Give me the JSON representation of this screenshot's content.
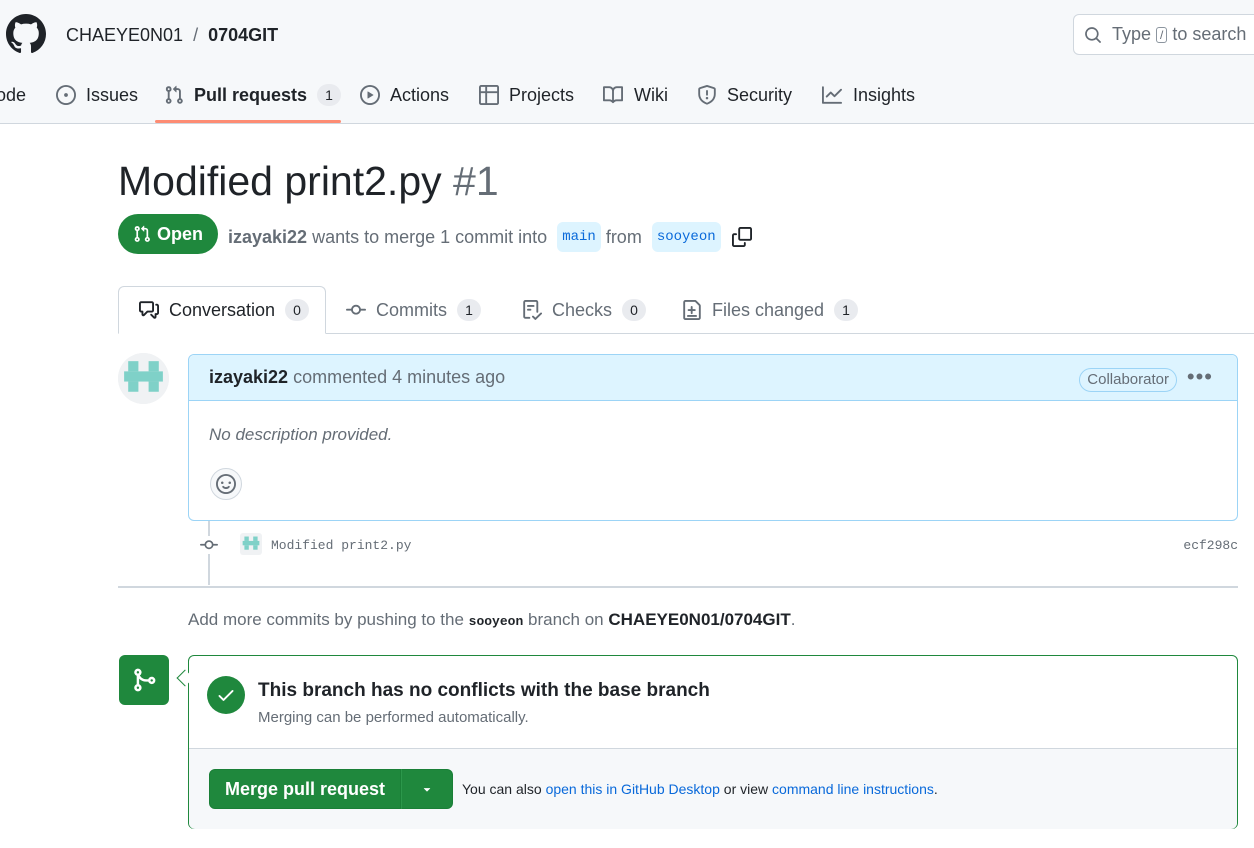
{
  "repo": {
    "owner": "CHAEYE0N01",
    "separator": "/",
    "name": "0704GIT"
  },
  "search": {
    "prefix": "Type",
    "key": "/",
    "suffix": "to search"
  },
  "nav": [
    {
      "label": "ode",
      "icon": "code-icon"
    },
    {
      "label": "Issues",
      "icon": "issue-icon"
    },
    {
      "label": "Pull requests",
      "count": "1",
      "icon": "pull-request-icon"
    },
    {
      "label": "Actions",
      "icon": "play-icon"
    },
    {
      "label": "Projects",
      "icon": "table-icon"
    },
    {
      "label": "Wiki",
      "icon": "book-icon"
    },
    {
      "label": "Security",
      "icon": "shield-icon"
    },
    {
      "label": "Insights",
      "icon": "graph-icon"
    }
  ],
  "pr": {
    "title": "Modified print2.py",
    "number": "#1",
    "state": "Open",
    "author": "izayaki22",
    "meta_text": "wants to merge 1 commit into",
    "base": "main",
    "from_text": "from",
    "head": "sooyeon"
  },
  "tabs": [
    {
      "label": "Conversation",
      "count": "0"
    },
    {
      "label": "Commits",
      "count": "1"
    },
    {
      "label": "Checks",
      "count": "0"
    },
    {
      "label": "Files changed",
      "count": "1"
    }
  ],
  "comment": {
    "author": "izayaki22",
    "action": "commented 4 minutes ago",
    "badge": "Collaborator",
    "body": "No description provided."
  },
  "commit": {
    "message": "Modified print2.py",
    "sha": "ecf298c"
  },
  "push_info": {
    "prefix": "Add more commits by pushing to the",
    "branch": "sooyeon",
    "middle": "branch on",
    "repo": "CHAEYE0N01/0704GIT",
    "suffix": "."
  },
  "merge": {
    "title": "This branch has no conflicts with the base branch",
    "subtitle": "Merging can be performed automatically.",
    "button": "Merge pull request",
    "note_prefix": "You can also",
    "desktop_link": "open this in GitHub Desktop",
    "note_middle": "or view",
    "cli_link": "command line instructions",
    "note_suffix": "."
  },
  "colors": {
    "accent_green": "#1f883d",
    "link_blue": "#0969da",
    "underline_orange": "#fd8c73",
    "comment_head_bg": "#ddf4ff"
  }
}
